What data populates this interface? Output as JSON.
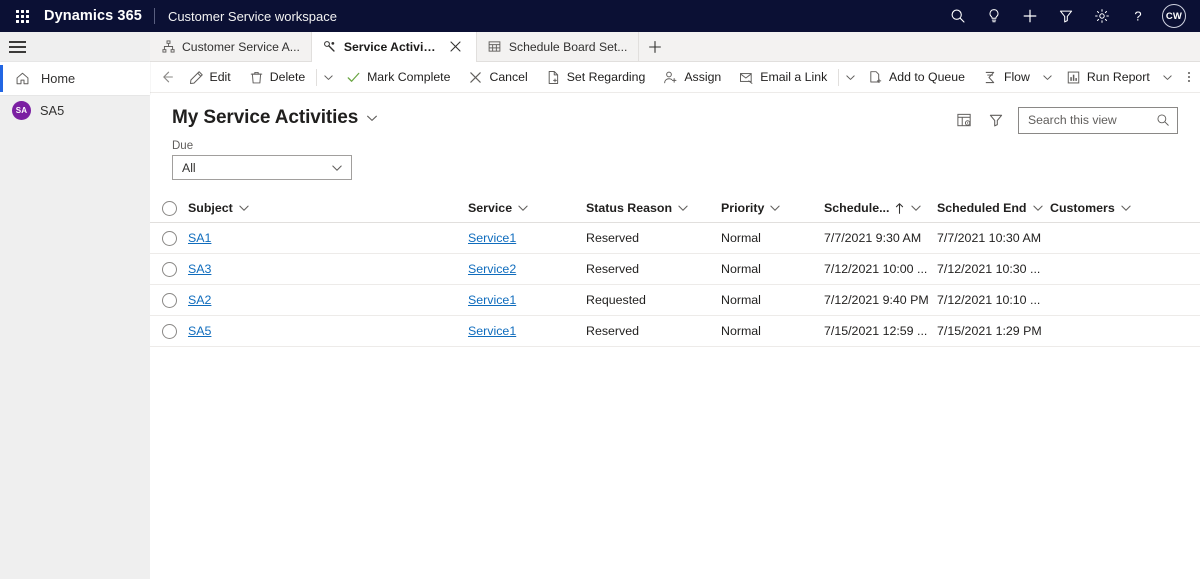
{
  "topbar": {
    "waffle_name": "app-launcher",
    "brand": "Dynamics 365",
    "app_name": "Customer Service workspace",
    "bg_color": "#0b1034",
    "icons": [
      "search-icon",
      "lightbulb-icon",
      "plus-icon",
      "filter-icon",
      "gear-icon",
      "help-icon"
    ],
    "avatar_initials": "CW"
  },
  "tabs": {
    "items": [
      {
        "label": "Customer Service A...",
        "icon": "sitemap-icon",
        "active": false,
        "closable": false
      },
      {
        "label": "Service Activities My Ser...",
        "icon": "service-activity-icon",
        "active": true,
        "closable": true
      },
      {
        "label": "Schedule Board Set...",
        "icon": "calendar-grid-icon",
        "active": false,
        "closable": false
      }
    ],
    "new_tab_label": "+"
  },
  "sidebar": {
    "items": [
      {
        "label": "Home",
        "icon": "home-icon",
        "selected": true,
        "type": "nav"
      },
      {
        "label": "SA5",
        "icon": "avatar",
        "initials": "SA",
        "selected": false,
        "type": "record",
        "avatar_color": "#7b1fa2"
      }
    ]
  },
  "commandbar": {
    "back_label": "Back",
    "buttons": [
      {
        "label": "Edit",
        "icon": "pencil-icon"
      },
      {
        "label": "Delete",
        "icon": "trash-icon"
      },
      {
        "label": "Mark Complete",
        "icon": "checkmark-icon"
      },
      {
        "label": "Cancel",
        "icon": "x-icon"
      },
      {
        "label": "Set Regarding",
        "icon": "document-add-icon"
      },
      {
        "label": "Assign",
        "icon": "person-add-icon"
      },
      {
        "label": "Email a Link",
        "icon": "email-link-icon"
      },
      {
        "label": "Add to Queue",
        "icon": "queue-add-icon"
      },
      {
        "label": "Flow",
        "icon": "flow-icon"
      },
      {
        "label": "Run Report",
        "icon": "report-icon"
      }
    ],
    "overflow_label": "More commands"
  },
  "view": {
    "title": "My Service Activities",
    "due_filter_label": "Due",
    "due_filter_value": "All",
    "due_filter_options": [
      "All"
    ],
    "edit_columns_icon": "edit-columns-icon",
    "edit_filters_icon": "edit-filters-icon"
  },
  "search": {
    "placeholder": "Search this view",
    "value": "",
    "icon": "search-icon"
  },
  "grid": {
    "columns": [
      {
        "key": "subject",
        "label": "Subject",
        "sorted": false
      },
      {
        "key": "service",
        "label": "Service",
        "sorted": false
      },
      {
        "key": "status",
        "label": "Status Reason",
        "sorted": false
      },
      {
        "key": "priority",
        "label": "Priority",
        "sorted": false
      },
      {
        "key": "start",
        "label": "Schedule...",
        "sorted": true,
        "sort_dir": "asc"
      },
      {
        "key": "end",
        "label": "Scheduled End",
        "sorted": false
      },
      {
        "key": "cust",
        "label": "Customers",
        "sorted": false
      }
    ],
    "rows": [
      {
        "subject": "SA1",
        "service": "Service1",
        "status": "Reserved",
        "priority": "Normal",
        "start": "7/7/2021 9:30 AM",
        "end": "7/7/2021 10:30 AM",
        "cust": ""
      },
      {
        "subject": "SA3",
        "service": "Service2",
        "status": "Reserved",
        "priority": "Normal",
        "start": "7/12/2021 10:00 ...",
        "end": "7/12/2021 10:30 ...",
        "cust": ""
      },
      {
        "subject": "SA2",
        "service": "Service1",
        "status": "Requested",
        "priority": "Normal",
        "start": "7/12/2021 9:40 PM",
        "end": "7/12/2021 10:10 ...",
        "cust": ""
      },
      {
        "subject": "SA5",
        "service": "Service1",
        "status": "Reserved",
        "priority": "Normal",
        "start": "7/15/2021 12:59 ...",
        "end": "7/15/2021 1:29 PM",
        "cust": ""
      }
    ]
  },
  "colors": {
    "nav_bg": "#0b1034",
    "link": "#0f6cbd",
    "accent_selected": "#2266e3",
    "avatar_purple": "#7b1fa2",
    "sidebar_bg": "#efefef"
  }
}
